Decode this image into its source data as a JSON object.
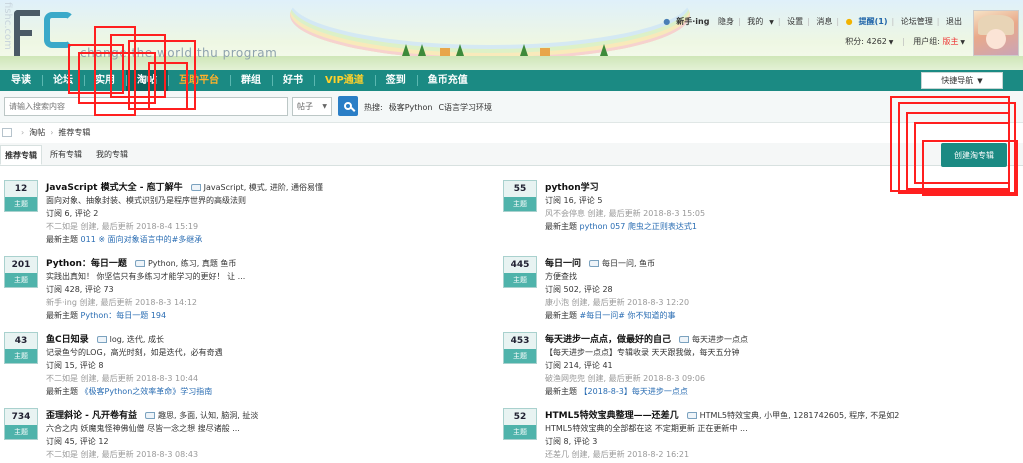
{
  "header": {
    "watermark": "fishc.com",
    "slogan": "change the world thu program",
    "user": {
      "name": "新手·ing",
      "links": [
        "隐身",
        "我的",
        "设置",
        "消息"
      ],
      "remind": "提醒(1)",
      "admin_links": [
        "论坛管理",
        "退出"
      ],
      "points_label": "积分: 4262",
      "group_label": "用户组:",
      "group_value": "版主"
    }
  },
  "nav": {
    "items": [
      "导读",
      "论坛",
      "实用",
      "淘帖",
      "互助平台",
      "群组",
      "好书",
      "VIP通道",
      "签到",
      "鱼币充值"
    ],
    "active_index": 3,
    "quick_nav": "快捷导航"
  },
  "search": {
    "placeholder": "请输入搜索内容",
    "type": "帖子",
    "hot_label": "热搜:",
    "hot_words": [
      "极客Python",
      "C语言学习环境"
    ]
  },
  "breadcrumb": [
    "淘帖",
    "推荐专辑"
  ],
  "tabs": [
    "推荐专辑",
    "所有专辑",
    "我的专辑"
  ],
  "create_button": "创建淘专辑",
  "collections": [
    {
      "count": "12",
      "badge": "主题",
      "title": "JavaScript 模式大全 - 庖丁解牛",
      "tags": "JavaScript, 模式, 进阶, 通俗易懂",
      "desc": "面向对象、抽象封装、模式识别乃是程序世界的高级法则",
      "stats": "订阅 6, 评论 2",
      "meta": "不二如是 创建, 最后更新 2018-8-4 15:19",
      "latest_label": "最新主题",
      "latest": "011 ※ 面向对象语言中的#多继承"
    },
    {
      "count": "55",
      "badge": "主题",
      "title": "python学习",
      "tags": "",
      "desc": "",
      "stats": "订阅 16, 评论 5",
      "meta": "风不会停息 创建, 最后更新 2018-8-3 15:05",
      "latest_label": "最新主题",
      "latest": "python 057 爬虫之正则表达式1"
    },
    {
      "count": "201",
      "badge": "主题",
      "title": "Python：每日一题",
      "tags": "Python, 练习, 真题 鱼币",
      "desc": "实践出真知！ 你坚信只有多练习才能学习的更好！ 让 ...",
      "stats": "订阅 428, 评论 73",
      "meta": "新手·ing 创建, 最后更新 2018-8-3 14:12",
      "latest_label": "最新主题",
      "latest": "Python：每日一题 194"
    },
    {
      "count": "445",
      "badge": "主题",
      "title": "每日一问",
      "tags": "每日一问, 鱼币",
      "desc": "方便查找",
      "stats": "订阅 502, 评论 28",
      "meta": "康小泡 创建, 最后更新 2018-8-3 12:20",
      "latest_label": "最新主题",
      "latest": "#每日一问# 你不知道的事"
    },
    {
      "count": "43",
      "badge": "主题",
      "title": "鱼C日知录",
      "tags": "log, 迭代, 成长",
      "desc": "记录鱼兮的LOG，高光时刻，如是迭代，必有奇遇",
      "stats": "订阅 15, 评论 8",
      "meta": "不二如是 创建, 最后更新 2018-8-3 10:44",
      "latest_label": "最新主题",
      "latest": "《极客Python之效率革命》学习指南"
    },
    {
      "count": "453",
      "badge": "主题",
      "title": "每天进步一点点，做最好的自己",
      "tags": "每天进步一点点",
      "desc": "【每天进步一点点】专辑收录 天天跟我做，每天五分钟",
      "stats": "订阅 214, 评论 41",
      "meta": "破渔网兜兜 创建, 最后更新 2018-8-3 09:06",
      "latest_label": "最新主题",
      "latest": "【2018-8-3】每天进步一点点"
    },
    {
      "count": "734",
      "badge": "主题",
      "title": "歪理斜论 - 凡开卷有益",
      "tags": "趣思, 多面, 认知, 脑洞, 扯淡",
      "desc": "六合之内 妖魔鬼怪神佛仙僧 尽皆一念之想 搜尽诸般 ...",
      "stats": "订阅 45, 评论 12",
      "meta": "不二如是 创建, 最后更新 2018-8-3 08:43",
      "latest_label": "",
      "latest": ""
    },
    {
      "count": "52",
      "badge": "主题",
      "title": "HTML5特效宝典整理——还差几",
      "tags": "HTML5特效宝典, 小甲鱼, 1281742605, 程序, 不是如2",
      "desc": "HTML5特效宝典的全部都在这 不定期更新 正在更新中 ...",
      "stats": "订阅 8, 评论 3",
      "meta": "还差几 创建, 最后更新 2018-8-2 16:21",
      "latest_label": "",
      "latest": ""
    }
  ],
  "colors": {
    "nav_bg": "#1b8a83",
    "nav_active": "#0f625d",
    "badge_bg": "#4fb3ab",
    "link": "#2a6db3",
    "annotation": "#ff1f1f"
  }
}
